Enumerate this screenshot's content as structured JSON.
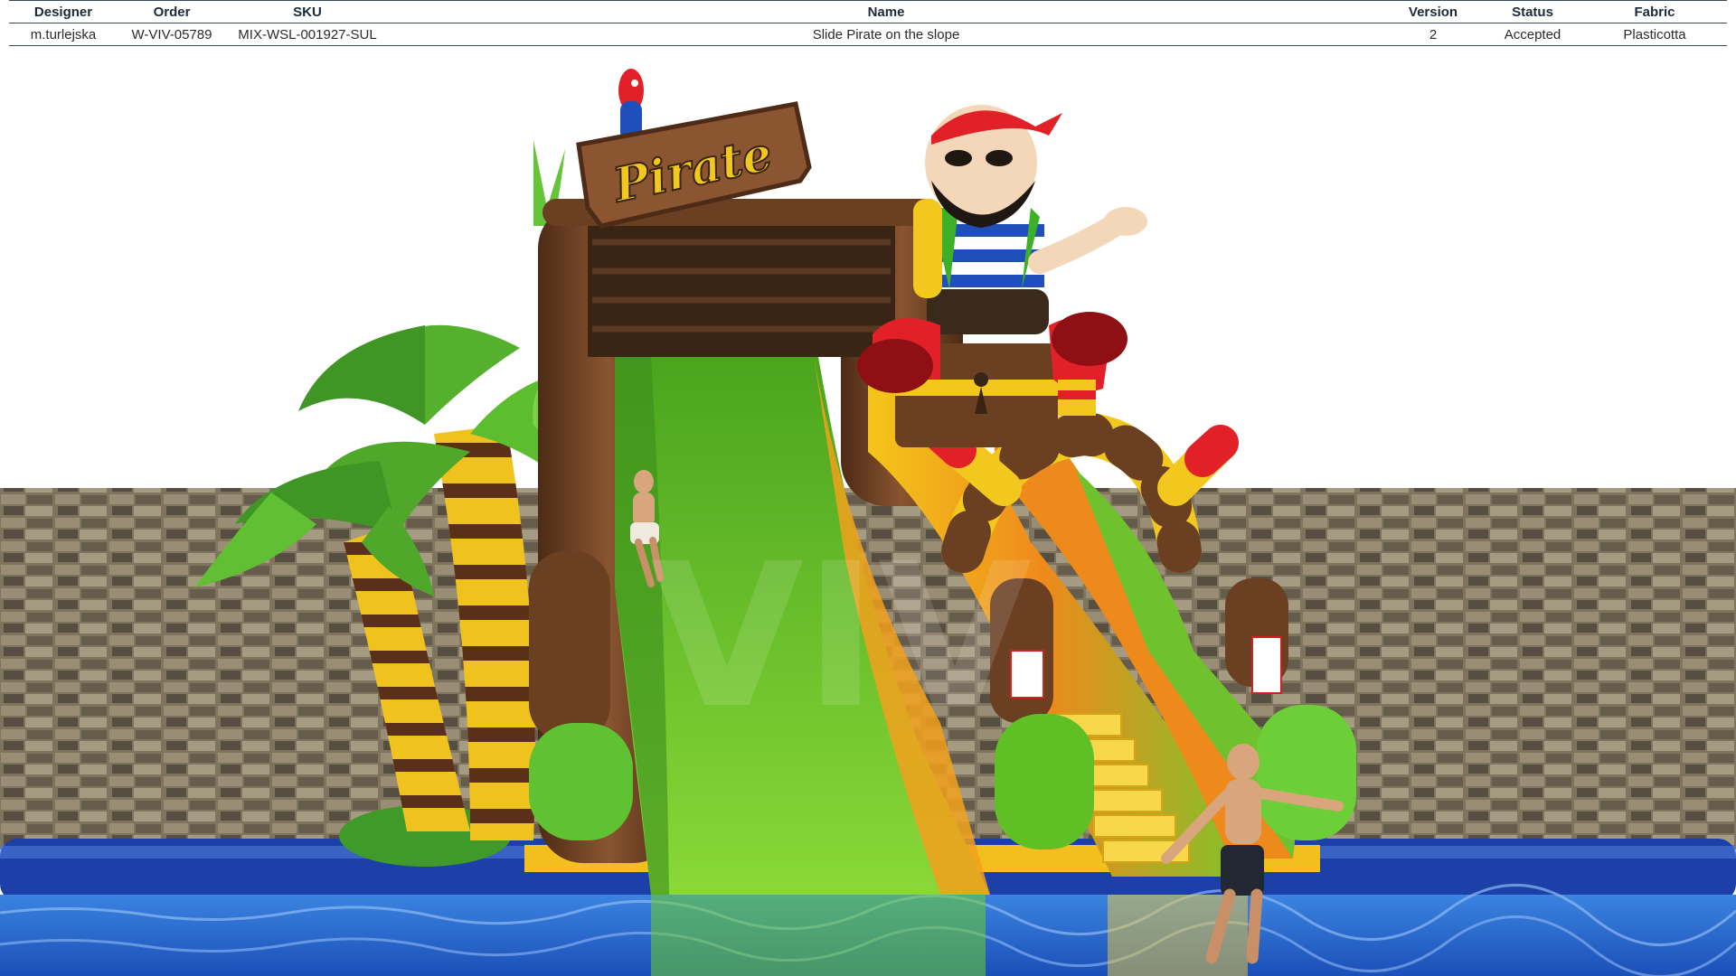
{
  "info_table": {
    "headers": [
      "Designer",
      "Order",
      "SKU",
      "Name",
      "Version",
      "Status",
      "Fabric"
    ],
    "row": [
      "m.turlejska",
      "W-VIV-05789",
      "MIX-WSL-001927-SUL",
      "Slide Pirate on the slope",
      "2",
      "Accepted",
      "Plasticotta"
    ]
  },
  "render": {
    "sign_text": "Pirate",
    "colors": {
      "stone_wall": "#8d8068",
      "water": "#2f6fcf",
      "slide_green": "#5fbf25",
      "slide_yellow": "#f2c01a",
      "slide_orange": "#ee8a1c",
      "frame_brown": "#6b3f22",
      "palm_green": "#4fa82a",
      "trunk_yellow": "#f0c21e",
      "trunk_stripe": "#5a3018",
      "pool_rim": "#1d3fa8",
      "pirate_red": "#e22028"
    }
  }
}
